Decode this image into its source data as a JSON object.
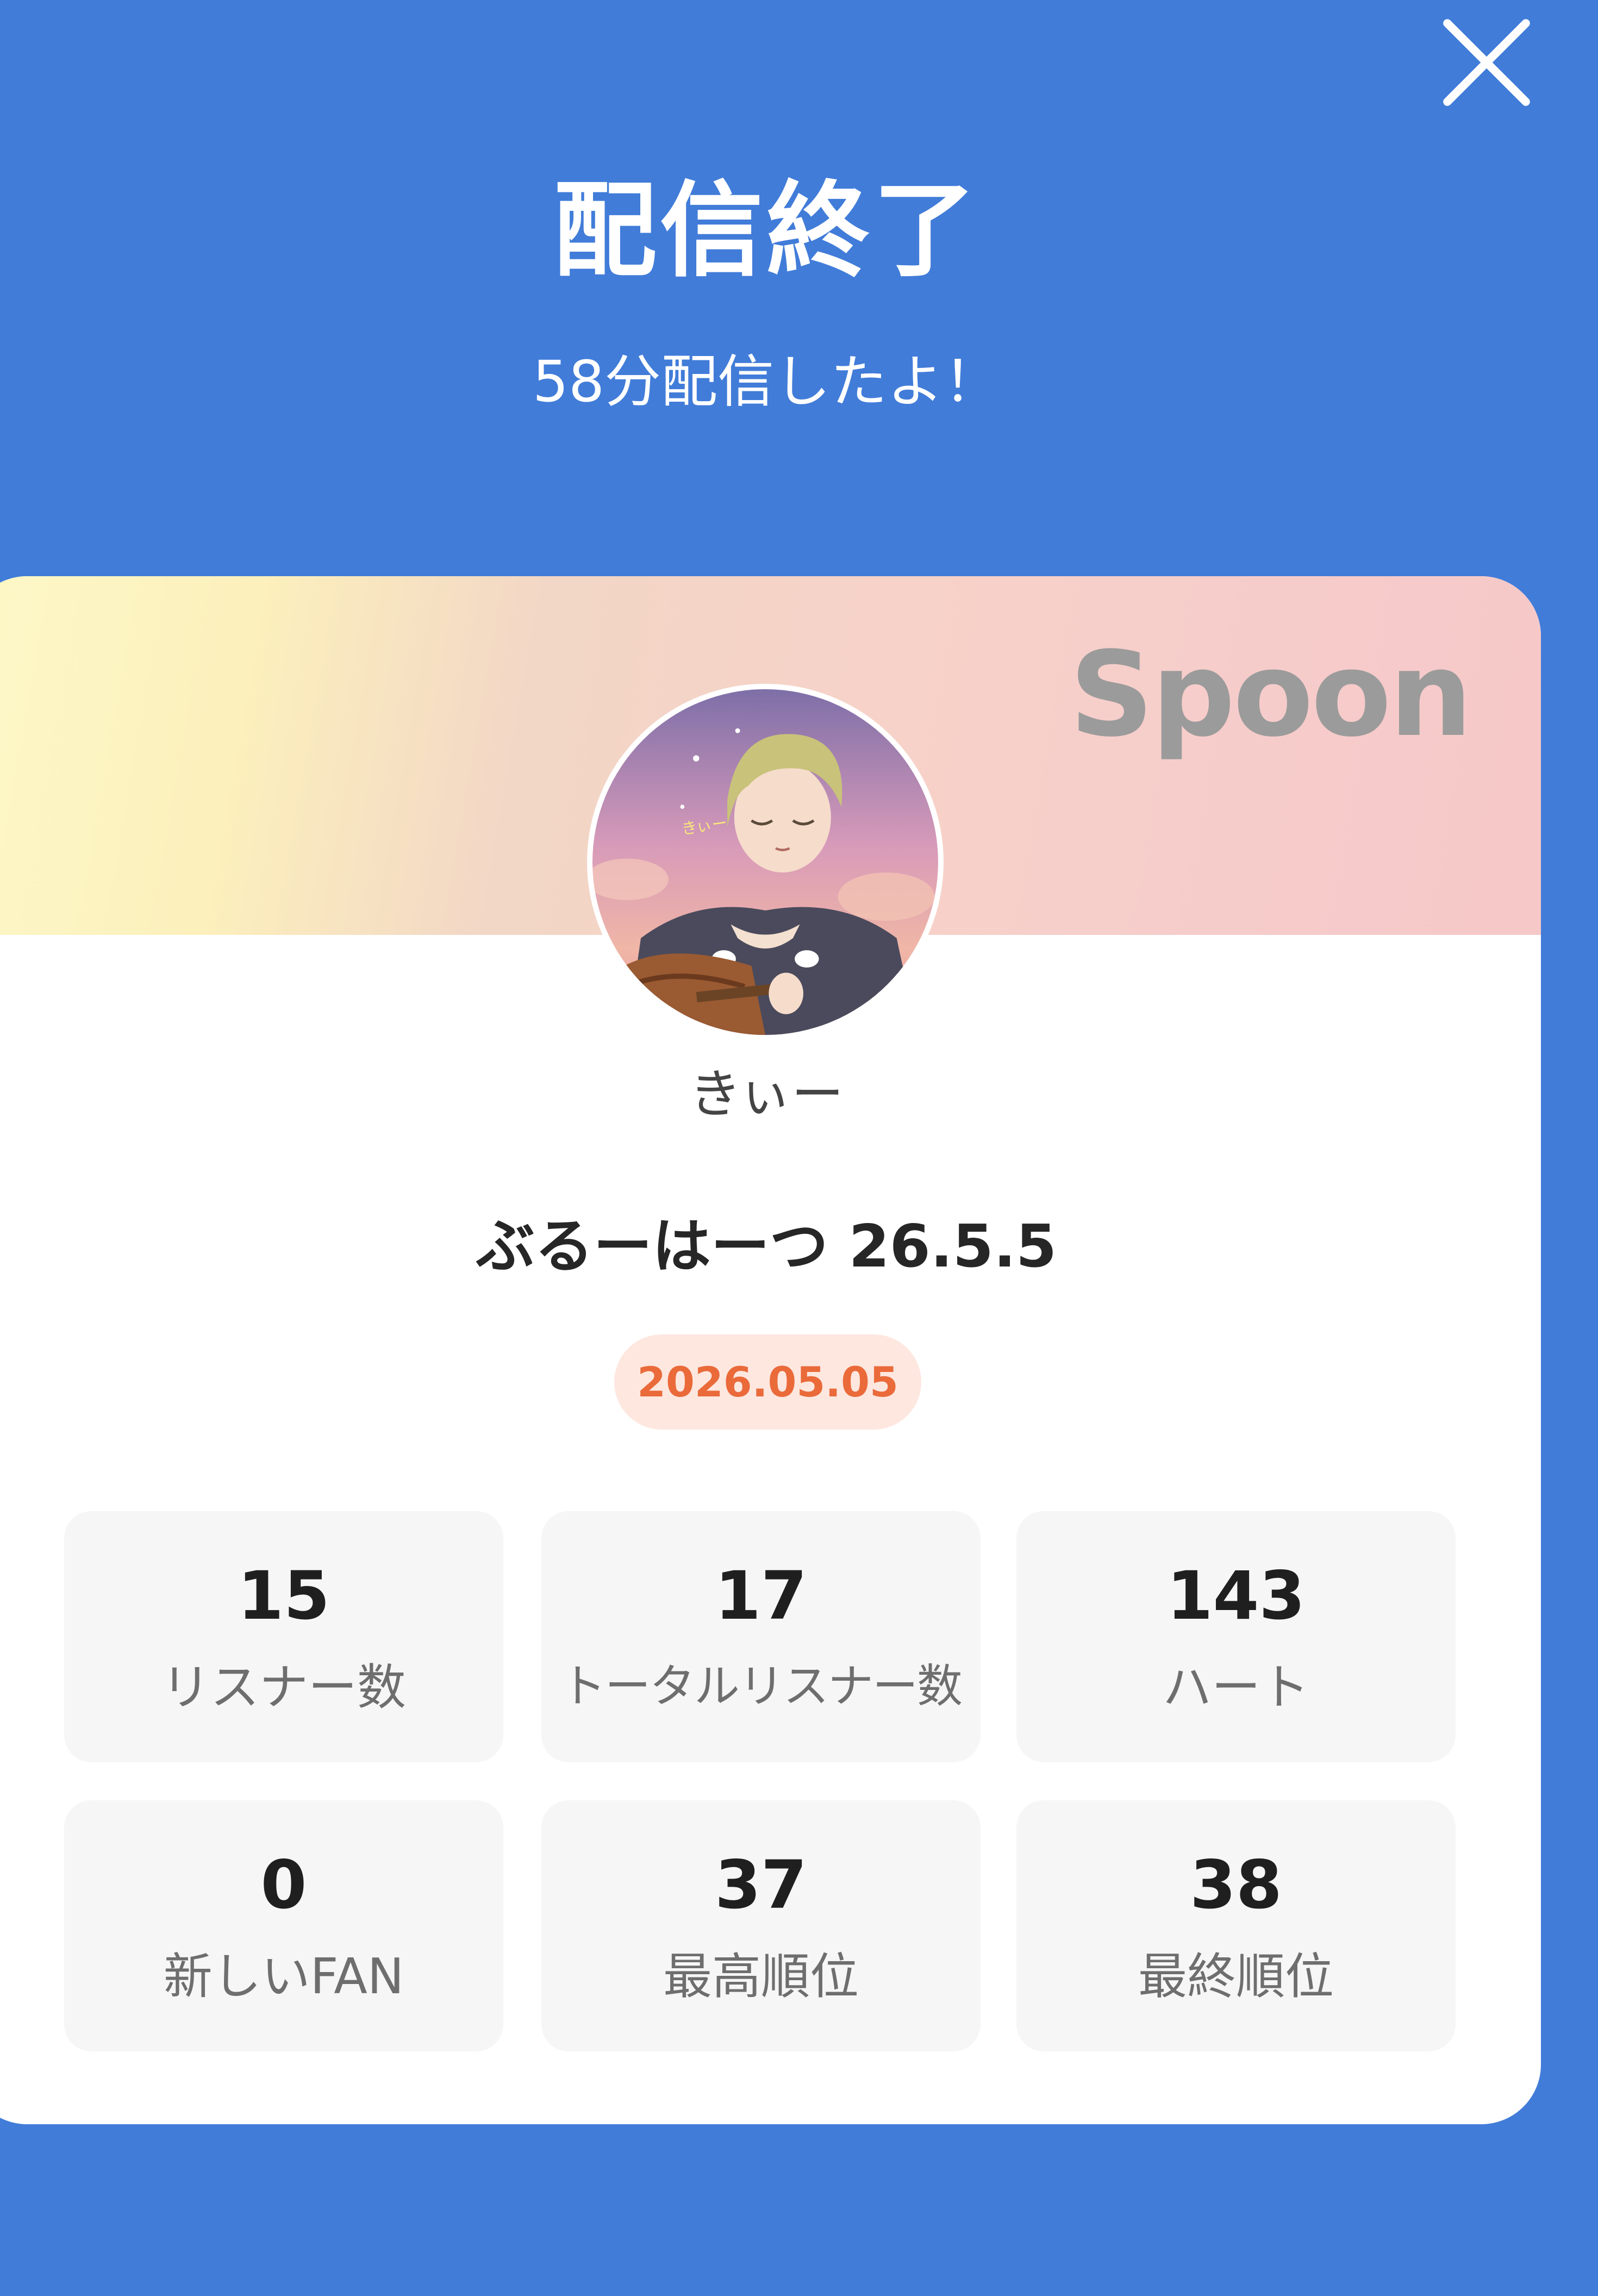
{
  "header": {
    "title": "配信終了",
    "subtitle": "58分配信したよ！"
  },
  "card": {
    "brand": "Spoon",
    "username": "きぃー",
    "live_title": "ぶるーはーつ 26.5.5",
    "date": "2026.05.05"
  },
  "stats": [
    {
      "value": "15",
      "label": "リスナー数"
    },
    {
      "value": "17",
      "label": "トータルリスナー数"
    },
    {
      "value": "143",
      "label": "ハート"
    },
    {
      "value": "0",
      "label": "新しいFAN"
    },
    {
      "value": "37",
      "label": "最高順位"
    },
    {
      "value": "38",
      "label": "最終順位"
    }
  ],
  "colors": {
    "background": "#417cd9",
    "accent": "#ea6a3a",
    "badge_bg": "#fde7df"
  },
  "icons": {
    "close": "close-icon",
    "avatar": "avatar-image"
  }
}
